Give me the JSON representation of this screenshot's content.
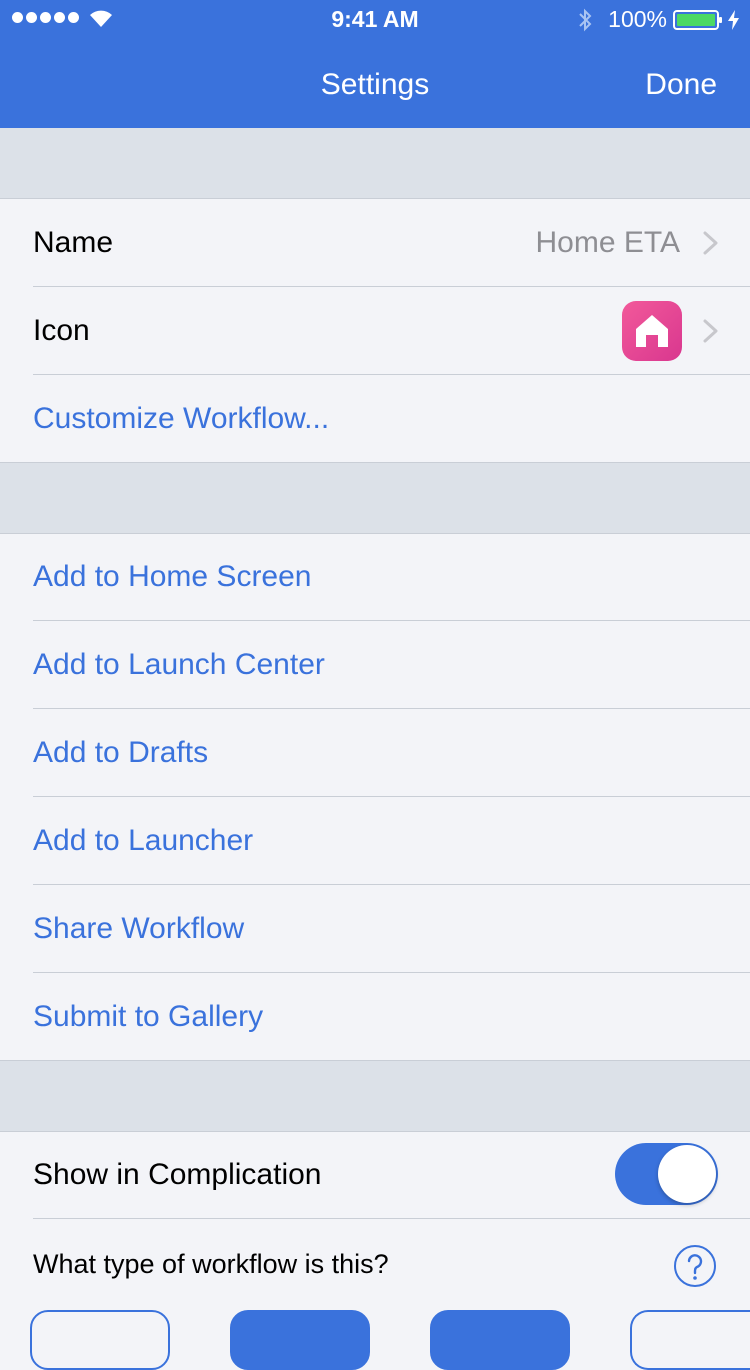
{
  "status_bar": {
    "time": "9:41 AM",
    "battery": "100%"
  },
  "nav": {
    "title": "Settings",
    "done_label": "Done"
  },
  "general": {
    "name_label": "Name",
    "name_value": "Home ETA",
    "icon_label": "Icon",
    "icon_glyph": "home-icon",
    "icon_color": "#e8458f",
    "customize_label": "Customize Workflow..."
  },
  "actions": [
    {
      "label": "Add to Home Screen"
    },
    {
      "label": "Add to Launch Center"
    },
    {
      "label": "Add to Drafts"
    },
    {
      "label": "Add to Launcher"
    },
    {
      "label": "Share Workflow"
    },
    {
      "label": "Submit to Gallery"
    }
  ],
  "complication": {
    "label": "Show in Complication",
    "enabled": true
  },
  "workflow_type": {
    "question": "What type of workflow is this?"
  },
  "colors": {
    "accent": "#3a72dc",
    "section_background": "#dce1e8",
    "row_background": "#f3f4f8"
  }
}
